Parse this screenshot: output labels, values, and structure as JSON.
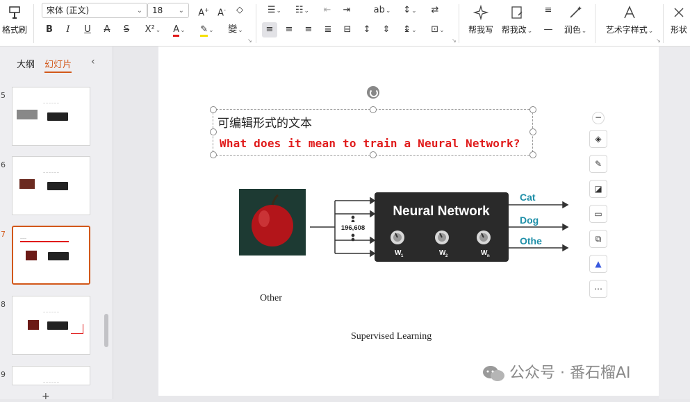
{
  "ribbon": {
    "format_painter": "格式刷",
    "font_name": "宋体 (正文)",
    "font_size": "18",
    "help_write": "帮我写",
    "help_edit": "帮我改",
    "polish": "润色",
    "art_text_style": "艺术字样式",
    "shape_style": "形状"
  },
  "left_panel": {
    "tab_outline": "大纲",
    "tab_slides": "幻灯片",
    "thumbnails": [
      {
        "number": "5"
      },
      {
        "number": "6"
      },
      {
        "number": "7"
      },
      {
        "number": "8"
      },
      {
        "number": "9"
      }
    ]
  },
  "slide": {
    "textbox_line1": "可编辑形式的文本",
    "textbox_line2": "What does it mean to train a Neural Network?",
    "nn_title": "Neural Network",
    "input_count": "196,608",
    "labels": {
      "cat": "Cat",
      "dog": "Dog",
      "other": "Othe"
    },
    "weights": {
      "w1": "W",
      "w1_sub": "1",
      "w2": "W",
      "w2_sub": "2",
      "wn": "W",
      "wn_sub": "n"
    },
    "caption_other": "Other",
    "caption_bottom": "Supervised Learning",
    "watermark": "公众号 · 番石榴AI"
  },
  "colors": {
    "accent_orange": "#d2581a",
    "red_text": "#e01a1a",
    "nn_box": "#2a2a2a",
    "label_teal": "#1f8fa8"
  }
}
